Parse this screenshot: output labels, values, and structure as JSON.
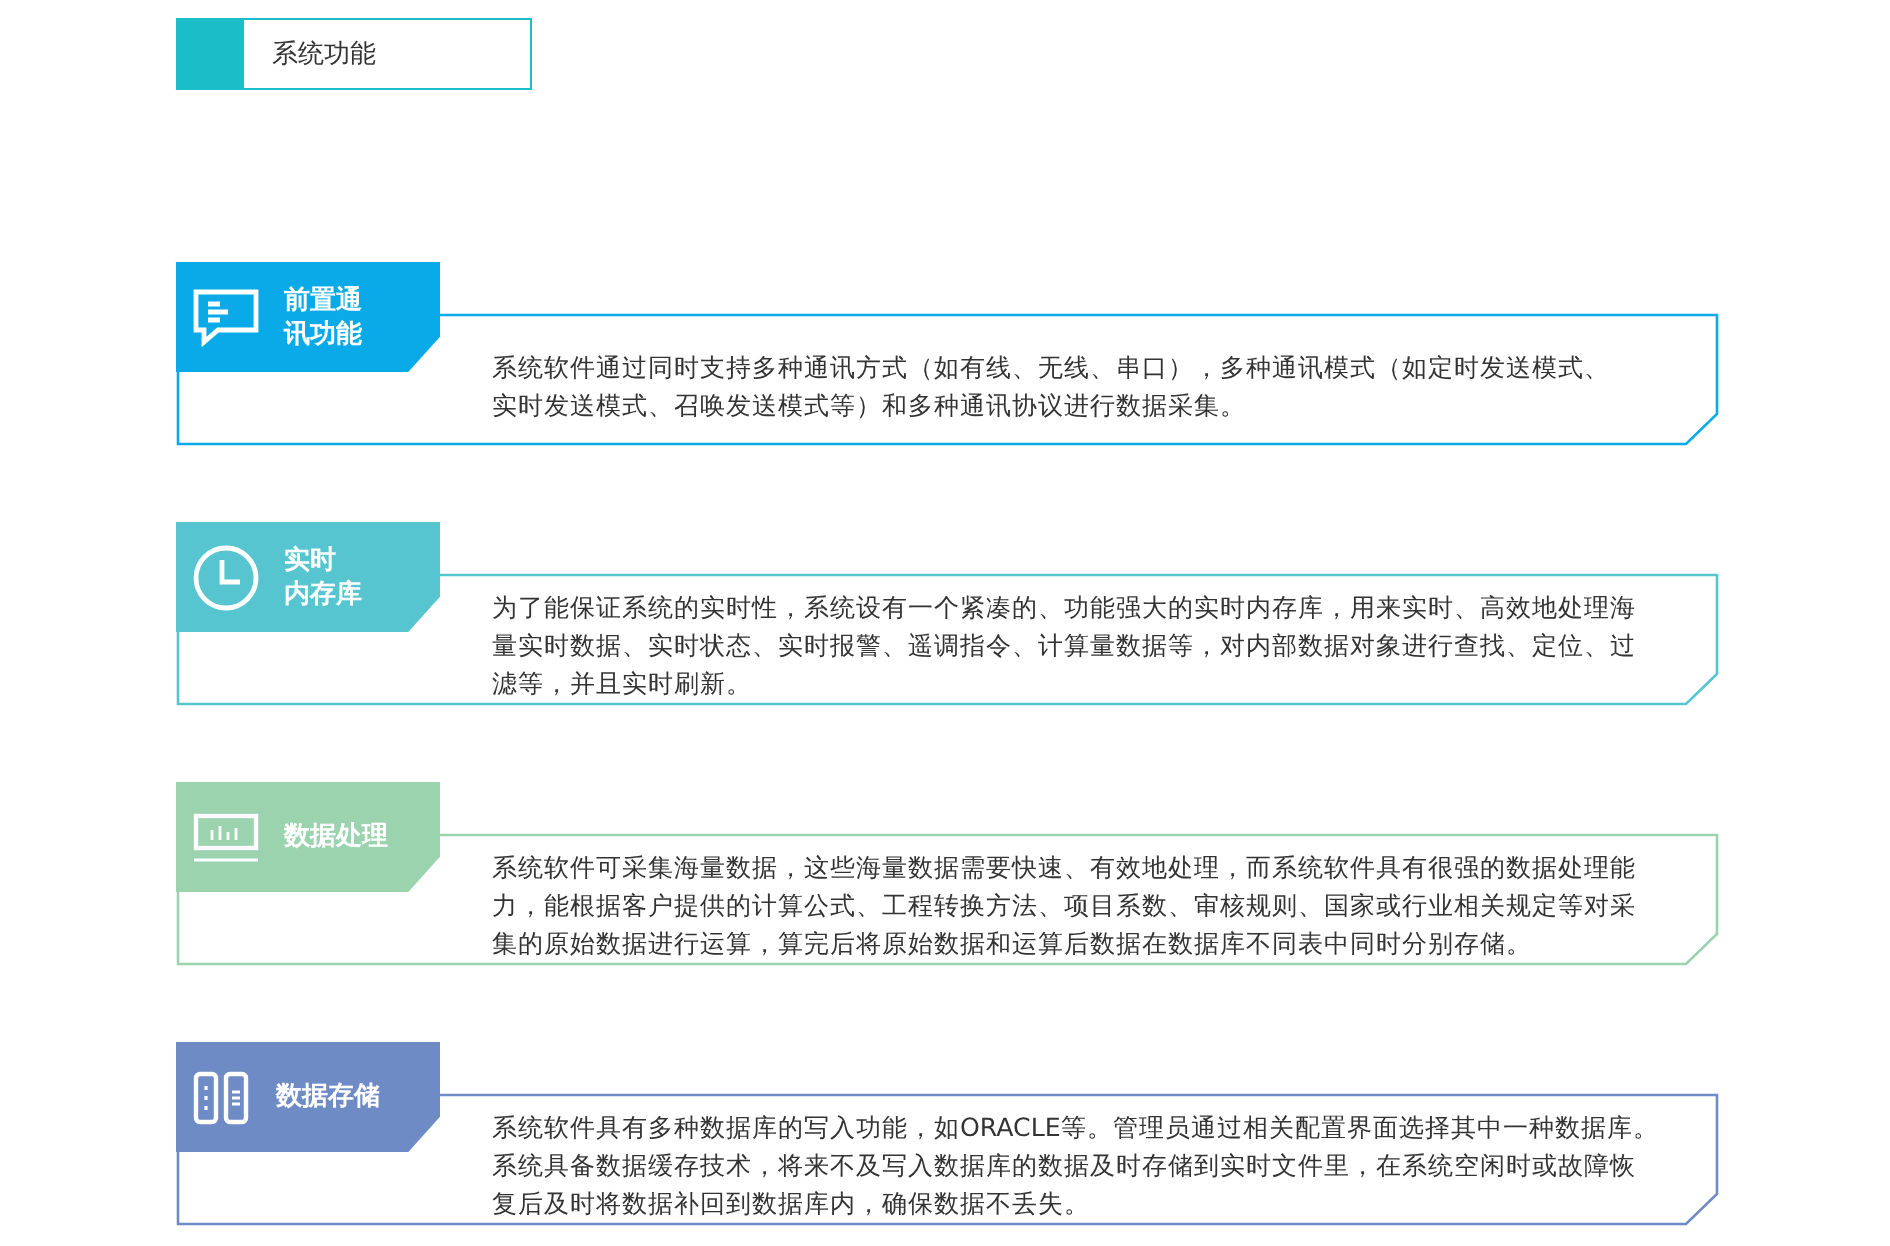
{
  "header": {
    "title": "系统功能"
  },
  "features": [
    {
      "title_lines": [
        "前置通",
        "讯功能"
      ],
      "color": "#0aaae9",
      "lines": [
        "系统软件通过同时支持多种通讯方式（如有线、无线、串口），多种通讯模式（如定时发送模式、",
        "实时发送模式、召唤发送模式等）和多种通讯协议进行数据采集。"
      ]
    },
    {
      "title_lines": [
        "实时",
        "内存库"
      ],
      "color": "#56c5d0",
      "lines": [
        "为了能保证系统的实时性，系统设有一个紧凑的、功能强大的实时内存库，用来实时、高效地处理海",
        "量实时数据、实时状态、实时报警、遥调指令、计算量数据等，对内部数据对象进行查找、定位、过",
        "滤等，并且实时刷新。"
      ]
    },
    {
      "title_lines": [
        "数据处理"
      ],
      "color": "#9bd3ae",
      "lines": [
        "系统软件可采集海量数据，这些海量数据需要快速、有效地处理，而系统软件具有很强的数据处理能",
        "力，能根据客户提供的计算公式、工程转换方法、项目系数、审核规则、国家或行业相关规定等对采",
        "集的原始数据进行运算，算完后将原始数据和运算后数据在数据库不同表中同时分别存储。"
      ]
    },
    {
      "title_lines": [
        "数据存储"
      ],
      "color": "#6e8bc6",
      "lines": [
        "系统软件具有多种数据库的写入功能，如ORACLE等。管理员通过相关配置界面选择其中一种数据库。",
        "系统具备数据缓存技术，将来不及写入数据库的数据及时存储到实时文件里，在系统空闲时或故障恢",
        "复后及时将数据补回到数据库内，确保数据不丢失。"
      ]
    }
  ]
}
